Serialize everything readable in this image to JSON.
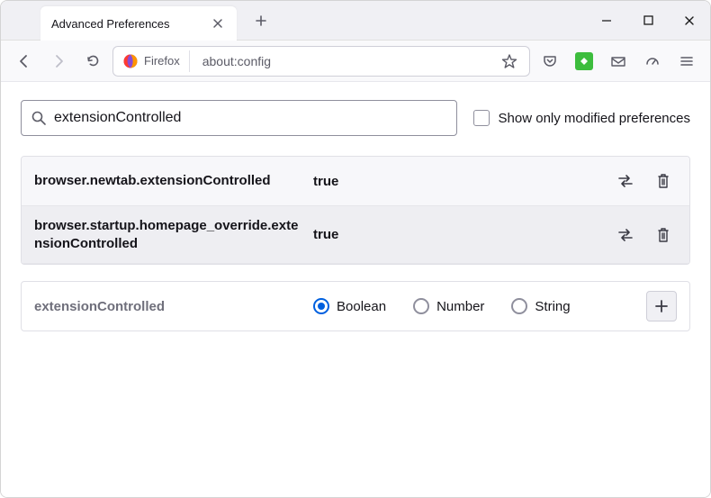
{
  "window": {
    "tab_title": "Advanced Preferences"
  },
  "urlbar": {
    "identity_label": "Firefox",
    "url": "about:config"
  },
  "config": {
    "search_value": "extensionControlled",
    "modified_only_label": "Show only modified preferences",
    "prefs": [
      {
        "name": "browser.newtab.extensionControlled",
        "value": "true"
      },
      {
        "name": "browser.startup.homepage_override.extensionControlled",
        "value": "true"
      }
    ],
    "new_pref_name": "extensionControlled",
    "type_options": {
      "boolean": "Boolean",
      "number": "Number",
      "string": "String"
    },
    "selected_type": "boolean"
  }
}
